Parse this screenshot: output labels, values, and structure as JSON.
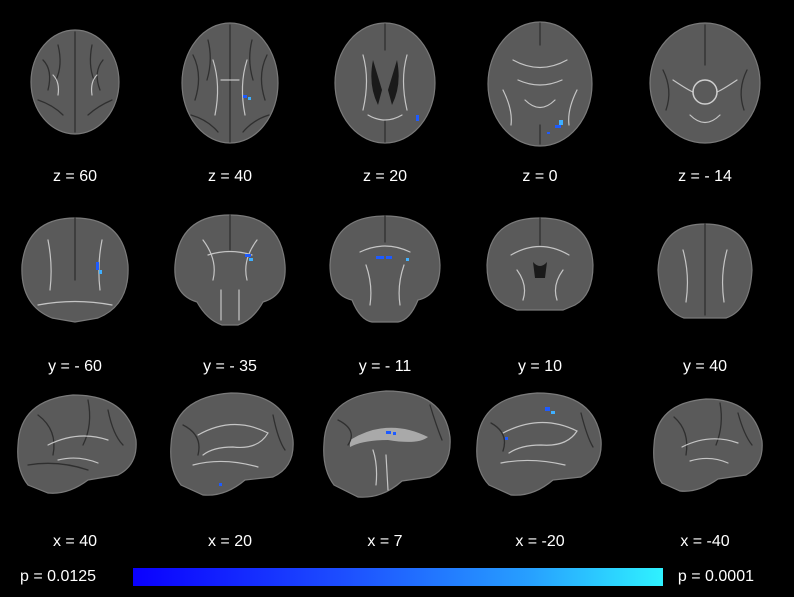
{
  "rows": [
    {
      "name": "axial",
      "panels": [
        {
          "label": "z = 60",
          "view": "axial-small"
        },
        {
          "label": "z = 40",
          "view": "axial"
        },
        {
          "label": "z = 20",
          "view": "axial"
        },
        {
          "label": "z = 0",
          "view": "axial"
        },
        {
          "label": "z = - 14",
          "view": "axial-low"
        }
      ]
    },
    {
      "name": "coronal",
      "panels": [
        {
          "label": "y = - 60",
          "view": "coronal"
        },
        {
          "label": "y = - 35",
          "view": "coronal"
        },
        {
          "label": "y = - 11",
          "view": "coronal"
        },
        {
          "label": "y = 10",
          "view": "coronal"
        },
        {
          "label": "y = 40",
          "view": "coronal-front"
        }
      ]
    },
    {
      "name": "sagittal",
      "panels": [
        {
          "label": "x = 40",
          "view": "sagittal"
        },
        {
          "label": "x = 20",
          "view": "sagittal"
        },
        {
          "label": "x = 7",
          "view": "sagittal-mid"
        },
        {
          "label": "x = -20",
          "view": "sagittal"
        },
        {
          "label": "x = -40",
          "view": "sagittal"
        }
      ]
    }
  ],
  "colorbar": {
    "left_label": "p = 0.0125",
    "right_label": "p = 0.0001",
    "colors": [
      "#0a00ff",
      "#1d4fff",
      "#27a0ff",
      "#2ff2ff"
    ]
  },
  "colors": {
    "background": "#000000",
    "brain": "#5a5a5a",
    "significant": "#1e5bff"
  }
}
